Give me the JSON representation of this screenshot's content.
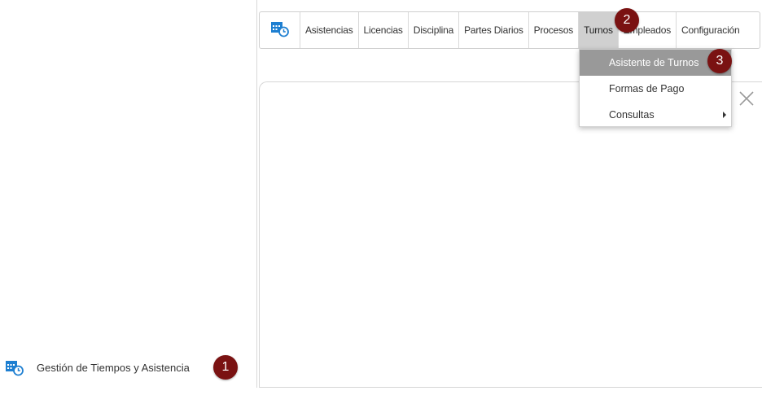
{
  "sidebar": {
    "module_icon": "calendar-clock-icon",
    "module_label": "Gestión de Tiempos y Asistencia"
  },
  "menubar": {
    "home_icon": "calendar-clock-icon",
    "items": [
      {
        "label": "Asistencias"
      },
      {
        "label": "Licencias"
      },
      {
        "label": "Disciplina"
      },
      {
        "label": "Partes Diarios"
      },
      {
        "label": "Procesos"
      },
      {
        "label": "Turnos"
      },
      {
        "label": "Empleados"
      },
      {
        "label": "Configuración"
      }
    ]
  },
  "dropdown": {
    "items": [
      {
        "label": "Asistente de Turnos"
      },
      {
        "label": "Formas de Pago"
      },
      {
        "label": "Consultas"
      }
    ]
  },
  "badges": [
    "1",
    "2",
    "3"
  ],
  "panel": {
    "close_icon": "close-icon"
  },
  "colors": {
    "badge": "#7a1212",
    "active_tab": "#d0d0d0",
    "selected_item": "#999999",
    "icon_blue": "#1e7fd1"
  }
}
